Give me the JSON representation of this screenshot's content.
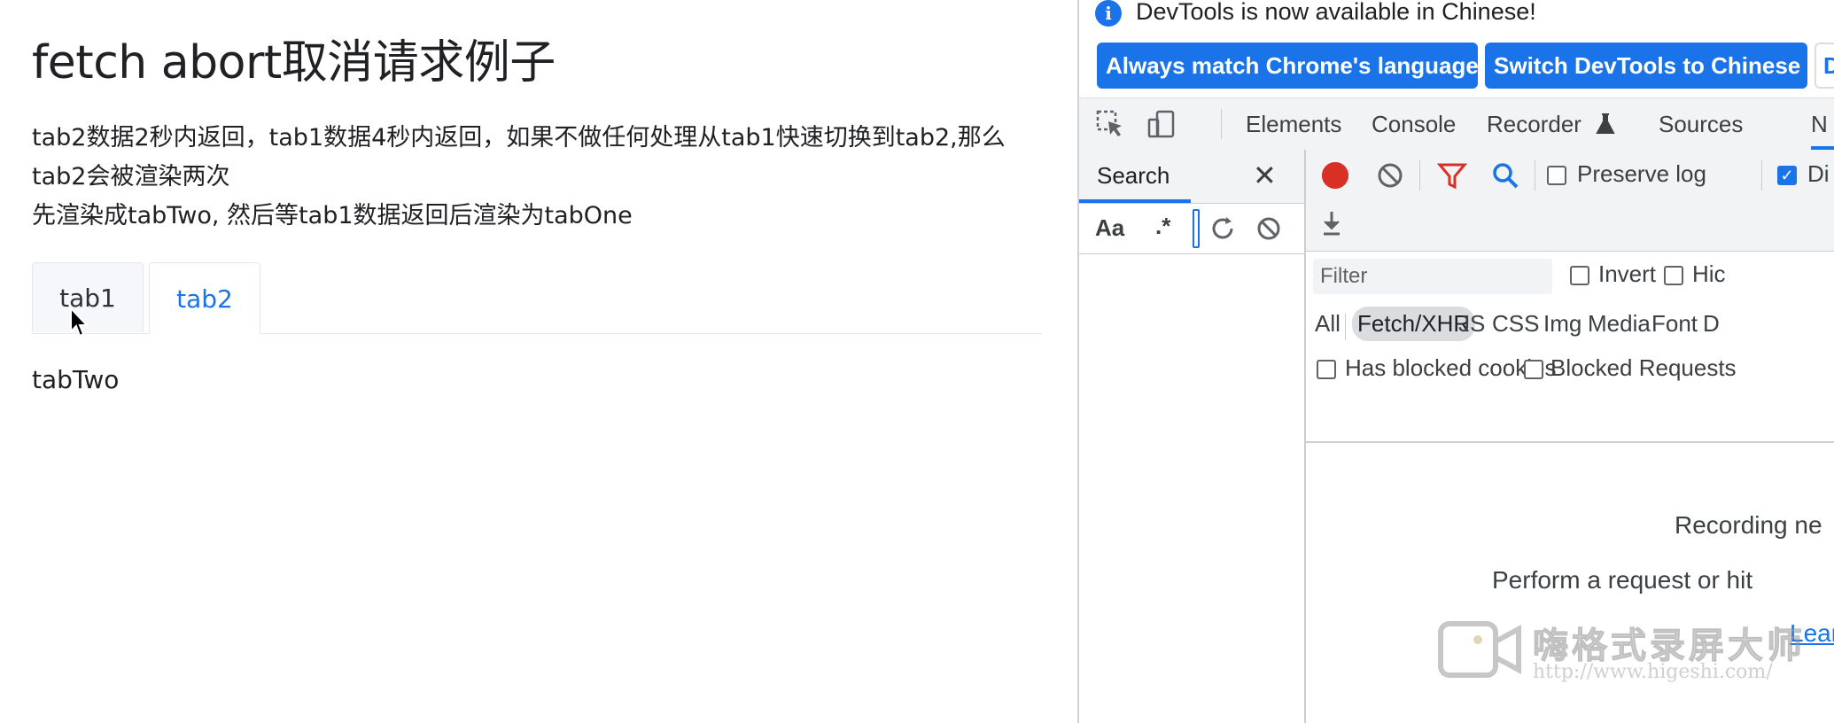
{
  "page": {
    "title": "fetch abort取消请求例子",
    "desc_line1": "tab2数据2秒内返回，tab1数据4秒内返回，如果不做任何处理从tab1快速切换到tab2,那么",
    "desc_line2": "tab2会被渲染两次",
    "desc_line3": "先渲染成tabTwo, 然后等tab1数据返回后渲染为tabOne",
    "tabs": [
      {
        "label": "tab1",
        "active": false
      },
      {
        "label": "tab2",
        "active": true
      }
    ],
    "content": "tabTwo"
  },
  "devtools": {
    "info_text": "DevTools is now available in Chinese!",
    "btn_match": "Always match Chrome's language",
    "btn_switch": "Switch DevTools to Chinese",
    "btn_dont": "D",
    "tabs": [
      "Elements",
      "Console",
      "Recorder",
      "Sources"
    ],
    "search": {
      "title": "Search",
      "case_label": "Aa",
      "regex_label": ".*"
    },
    "network": {
      "preserve_log": "Preserve log",
      "disable_cache": "Di",
      "filter_placeholder": "Filter",
      "invert": "Invert",
      "hide": "Hic",
      "types": [
        "All",
        "Fetch/XHR",
        "JS",
        "CSS",
        "Img",
        "Media",
        "Font",
        "D"
      ],
      "active_type": "Fetch/XHR",
      "has_blocked_cookies": "Has blocked cookies",
      "blocked_requests": "Blocked Requests",
      "empty_line1": "Recording ne",
      "empty_line2": "Perform a request or hit",
      "learn_more": "Lear"
    }
  },
  "watermark": {
    "title": "嗨格式录屏大师",
    "url": "http://www.higeshi.com/"
  },
  "colors": {
    "accent": "#1a73e8",
    "record": "#d93025",
    "toolbar_bg": "#f1f3f4"
  }
}
